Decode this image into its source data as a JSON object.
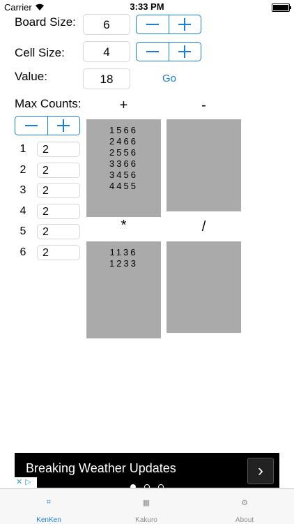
{
  "status_bar": {
    "carrier": "Carrier",
    "time": "3:33 PM"
  },
  "controls": {
    "board_size_label": "Board Size:",
    "board_size_value": "6",
    "cell_size_label": "Cell Size:",
    "cell_size_value": "4",
    "value_label": "Value:",
    "value_value": "18",
    "go_label": "Go",
    "max_counts_label": "Max Counts:",
    "minus": "−",
    "plus": "+"
  },
  "max_counts": [
    {
      "n": "1",
      "v": "2"
    },
    {
      "n": "2",
      "v": "2"
    },
    {
      "n": "3",
      "v": "2"
    },
    {
      "n": "4",
      "v": "2"
    },
    {
      "n": "5",
      "v": "2"
    },
    {
      "n": "6",
      "v": "2"
    }
  ],
  "operations": {
    "plus": {
      "symbol": "+",
      "lines": [
        "1566",
        "2466",
        "2556",
        "3366",
        "3456",
        "4455"
      ]
    },
    "minus": {
      "symbol": "-",
      "lines": []
    },
    "times": {
      "symbol": "*",
      "lines": [
        "1136",
        "1233"
      ]
    },
    "divide": {
      "symbol": "/",
      "lines": []
    }
  },
  "ad": {
    "text": "Breaking Weather Updates",
    "arrow": "›",
    "choices_x": "✕",
    "choices_tri": "▷"
  },
  "tabs": [
    {
      "label": "KenKen",
      "icon": "grid-icon",
      "glyph": "⌗"
    },
    {
      "label": "Kakuro",
      "icon": "kakuro-icon",
      "glyph": "▦"
    },
    {
      "label": "About",
      "icon": "gear-icon",
      "glyph": "⚙"
    }
  ],
  "colors": {
    "accent": "#1a7dd8",
    "panel": "#aaaaaa"
  }
}
